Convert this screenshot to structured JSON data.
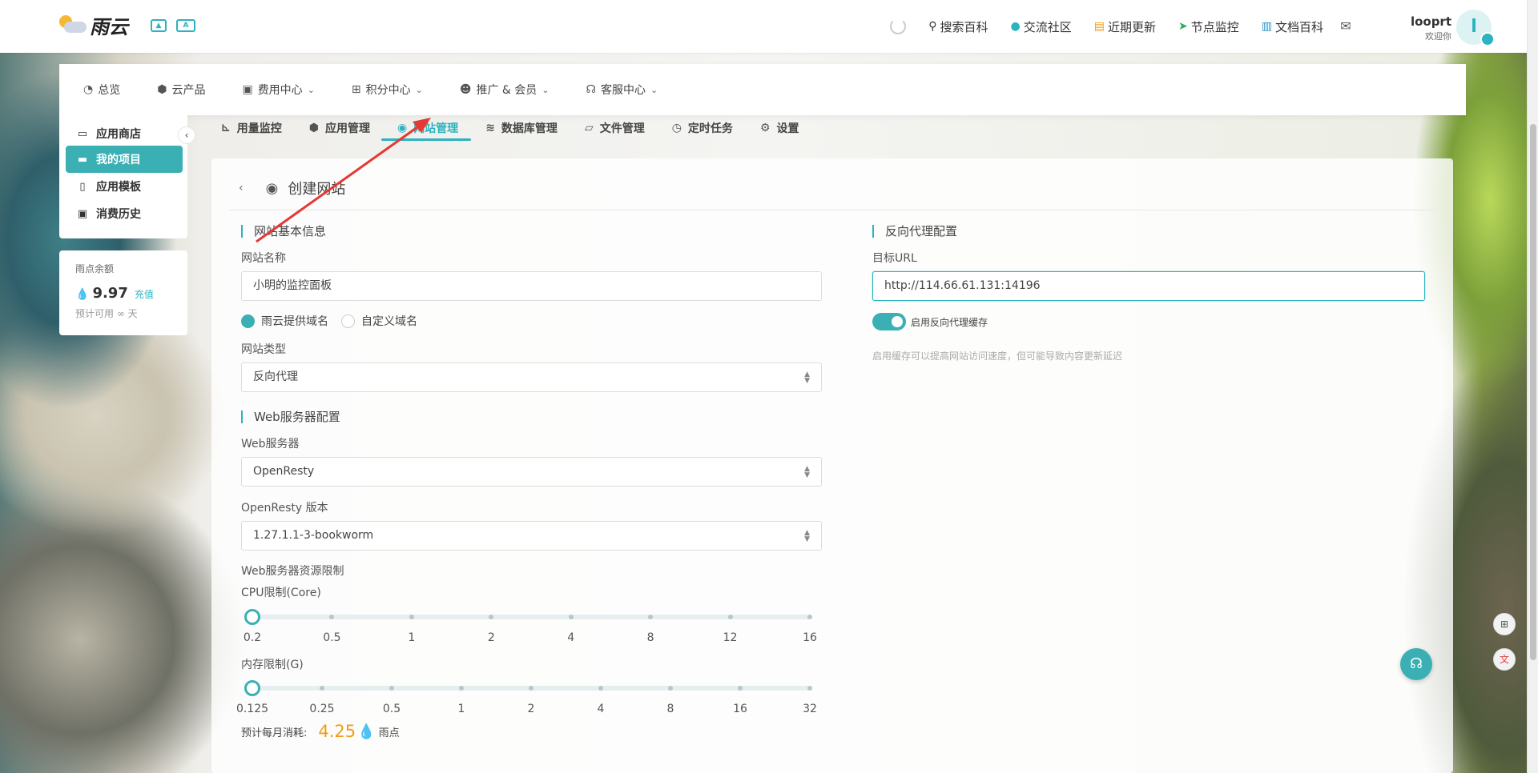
{
  "header": {
    "logo_text": "雨云",
    "image_icon": "image-icon",
    "translate_icon_text": "A",
    "nav": [
      {
        "label": "搜索百科",
        "icon": "search-icon",
        "glyph": "⚲"
      },
      {
        "label": "交流社区",
        "icon": "qq-icon",
        "glyph": "●"
      },
      {
        "label": "近期更新",
        "icon": "news-icon",
        "glyph": "▤"
      },
      {
        "label": "节点监控",
        "icon": "location-arrow-icon",
        "glyph": "➤"
      },
      {
        "label": "文档百科",
        "icon": "book-icon",
        "glyph": "▥"
      }
    ],
    "user_name": "looprt",
    "user_greeting": "欢迎你",
    "avatar_letter": "l"
  },
  "main_nav": [
    {
      "label": "总览",
      "icon": "dashboard-icon",
      "glyph": "◔",
      "dropdown": false
    },
    {
      "label": "云产品",
      "icon": "cubes-icon",
      "glyph": "⬢",
      "dropdown": false
    },
    {
      "label": "费用中心",
      "icon": "money-icon",
      "glyph": "▣",
      "dropdown": true
    },
    {
      "label": "积分中心",
      "icon": "gift-icon",
      "glyph": "⊞",
      "dropdown": true
    },
    {
      "label": "推广 & 会员",
      "icon": "users-icon",
      "glyph": "☻",
      "dropdown": true
    },
    {
      "label": "客服中心",
      "icon": "headset-icon",
      "glyph": "☊",
      "dropdown": true
    }
  ],
  "sidebar": {
    "items": [
      {
        "label": "应用商店",
        "icon": "store-icon",
        "glyph": "▭",
        "active": false
      },
      {
        "label": "我的项目",
        "icon": "folder-icon",
        "glyph": "▬",
        "active": true
      },
      {
        "label": "应用模板",
        "icon": "file-code-icon",
        "glyph": "▯",
        "active": false
      },
      {
        "label": "消费历史",
        "icon": "money-bill-icon",
        "glyph": "▣",
        "active": false
      }
    ]
  },
  "balance": {
    "title": "雨点余额",
    "amount": "9.97",
    "recharge": "充值",
    "estimate": "预计可用 ∞ 天"
  },
  "tabs": [
    {
      "label": "用量监控",
      "icon": "chart-icon",
      "glyph": "⊾",
      "active": false
    },
    {
      "label": "应用管理",
      "icon": "cubes-icon",
      "glyph": "⬢",
      "active": false
    },
    {
      "label": "网站管理",
      "icon": "globe-icon",
      "glyph": "◉",
      "active": true
    },
    {
      "label": "数据库管理",
      "icon": "database-icon",
      "glyph": "≋",
      "active": false
    },
    {
      "label": "文件管理",
      "icon": "folder-open-icon",
      "glyph": "▱",
      "active": false
    },
    {
      "label": "定时任务",
      "icon": "clock-icon",
      "glyph": "◷",
      "active": false
    },
    {
      "label": "设置",
      "icon": "cogs-icon",
      "glyph": "⚙",
      "active": false
    }
  ],
  "form": {
    "page_title": "创建网站",
    "basic_section": "网站基本信息",
    "site_name_label": "网站名称",
    "site_name_value": "小明的监控面板",
    "domain_options": [
      {
        "label": "雨云提供域名",
        "selected": true
      },
      {
        "label": "自定义域名",
        "selected": false
      }
    ],
    "site_type_label": "网站类型",
    "site_type_value": "反向代理",
    "web_section": "Web服务器配置",
    "web_server_label": "Web服务器",
    "web_server_value": "OpenResty",
    "version_label": "OpenResty 版本",
    "version_value": "1.27.1.1-3-bookworm",
    "resource_label": "Web服务器资源限制",
    "cpu_label": "CPU限制(Core)",
    "cpu_ticks": [
      "0.2",
      "0.5",
      "1",
      "2",
      "4",
      "8",
      "12",
      "16"
    ],
    "cpu_selected_index": 0,
    "mem_label": "内存限制(G)",
    "mem_ticks": [
      "0.125",
      "0.25",
      "0.5",
      "1",
      "2",
      "4",
      "8",
      "16",
      "32"
    ],
    "mem_selected_index": 0,
    "monthly_label": "预计每月消耗:",
    "monthly_value": "4.25",
    "monthly_unit": "雨点",
    "proxy_section": "反向代理配置",
    "target_url_label": "目标URL",
    "target_url_value": "http://114.66.61.131:14196",
    "cache_toggle_label": "启用反向代理缓存",
    "cache_toggle_on": true,
    "cache_hint": "启用缓存可以提高网站访问速度，但可能导致内容更新延迟"
  },
  "colors": {
    "accent": "#3ab0b5",
    "cost": "#f39c12",
    "annotation_arrow": "#e53935"
  }
}
